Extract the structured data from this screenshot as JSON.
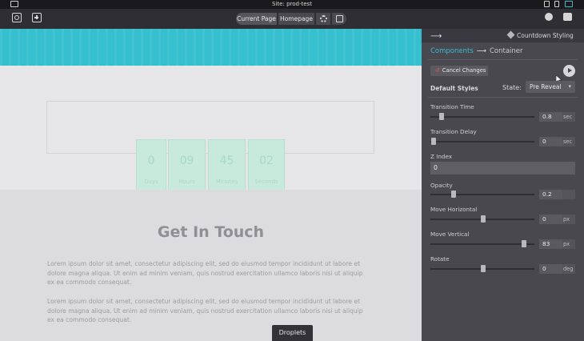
{
  "os_bar": {
    "title": "Site: prod-test"
  },
  "toolbar": {
    "current_page_label": "Current Page",
    "homepage_label": "Homepage"
  },
  "canvas": {
    "countdown": [
      {
        "number": "0",
        "unit": "Days"
      },
      {
        "number": "09",
        "unit": "Hours"
      },
      {
        "number": "45",
        "unit": "Minutes"
      },
      {
        "number": "02",
        "unit": "Seconds"
      }
    ],
    "heading": "Get In Touch",
    "paragraph1": "Lorem ipsum dolor sit amet, consectetur adipiscing elit, sed do eiusmod tempor incididunt ut labore et dolore magna aliqua. Ut enim ad minim veniam, quis nostrud exercitation ullamco laboris nisi ut aliquip ex ea commodo consequat.",
    "paragraph2": "Lorem ipsum dolor sit amet, consectetur adipiscing elit, sed do eiusmod tempor incididunt ut labore et dolore magna aliqua. Ut enim ad minim veniam, quis nostrud exercitation ullamco laboris nisi ut aliquip ex ea commodo consequat.",
    "droplets_label": "Droplets",
    "accent_color": "#35bfcf"
  },
  "panel": {
    "header_right": "Countdown Styling",
    "breadcrumb": {
      "components": "Components",
      "container": "Container"
    },
    "cancel_label": "Cancel Changes",
    "default_styles_label": "Default Styles",
    "state_label": "State:",
    "state_value": "Pre Reveal",
    "transition_time": {
      "label": "Transition Time",
      "value": "0.8",
      "unit": "sec",
      "slider_fraction": 0.1
    },
    "transition_delay": {
      "label": "Transition Delay",
      "value": "0",
      "unit": "sec",
      "slider_fraction": 0.0
    },
    "z_index": {
      "label": "Z Index",
      "value": "0"
    },
    "opacity": {
      "label": "Opacity",
      "value": "0.2",
      "unit": "",
      "slider_fraction": 0.2
    },
    "move_horizontal": {
      "label": "Move Horizontal",
      "value": "0",
      "unit": "px",
      "slider_fraction": 0.5
    },
    "move_vertical": {
      "label": "Move Vertical",
      "value": "83",
      "unit": "px",
      "slider_fraction": 0.93
    },
    "rotate": {
      "label": "Rotate",
      "value": "0",
      "unit": "deg",
      "slider_fraction": 0.5
    },
    "accent_color": "#3fb9cf"
  }
}
